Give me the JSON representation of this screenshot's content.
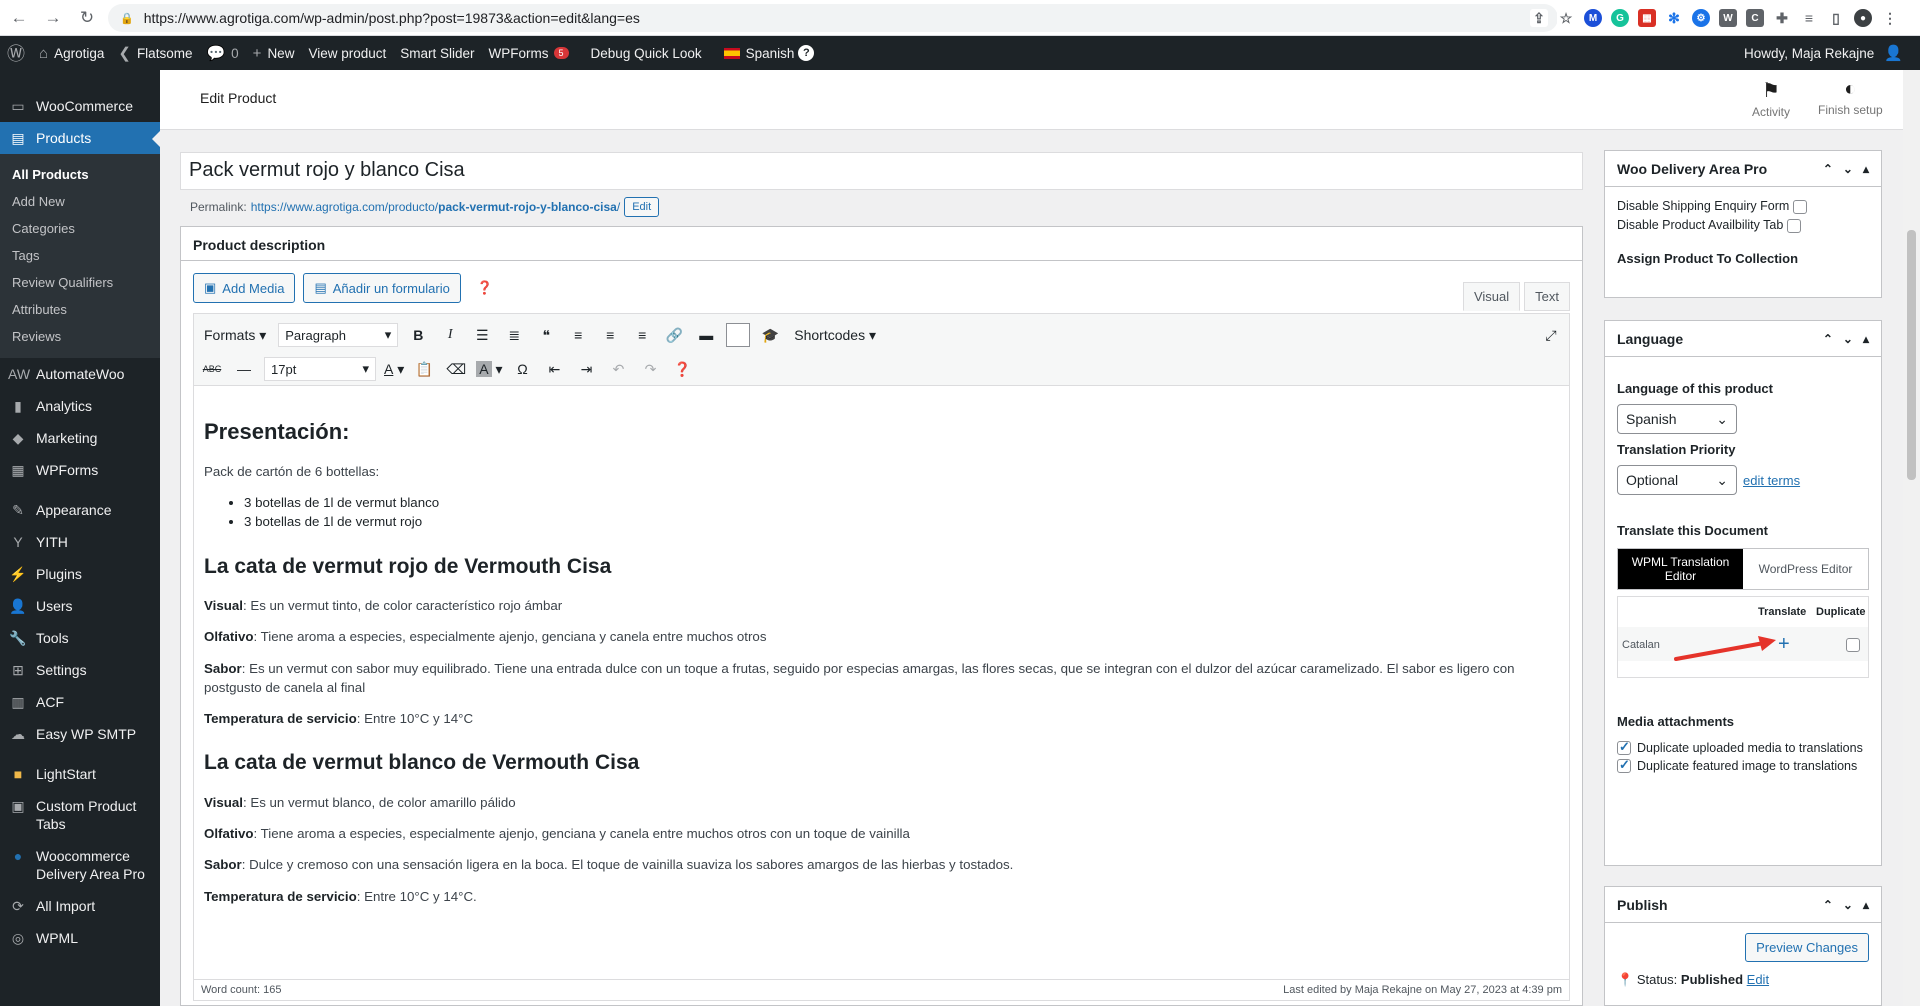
{
  "browser": {
    "url": "https://www.agrotiga.com/wp-admin/post.php?post=19873&action=edit&lang=es"
  },
  "adminbar": {
    "site": "Agrotiga",
    "theme": "Flatsome",
    "comments": "0",
    "new": "New",
    "view_product": "View product",
    "smart_slider": "Smart Slider",
    "wpforms": "WPForms",
    "wpforms_badge": "5",
    "debug": "Debug Quick Look",
    "language": "Spanish",
    "howdy": "Howdy, Maja Rekajne"
  },
  "sidebar": {
    "items": [
      {
        "label": "WooCommerce",
        "icon": "woo-icon"
      },
      {
        "label": "Products",
        "icon": "products-icon"
      },
      {
        "label": "AutomateWoo",
        "icon": "aw-icon"
      },
      {
        "label": "Analytics",
        "icon": "analytics-icon"
      },
      {
        "label": "Marketing",
        "icon": "marketing-icon"
      },
      {
        "label": "WPForms",
        "icon": "wpforms-icon"
      },
      {
        "label": "Appearance",
        "icon": "appearance-icon"
      },
      {
        "label": "YITH",
        "icon": "yith-icon"
      },
      {
        "label": "Plugins",
        "icon": "plugins-icon"
      },
      {
        "label": "Users",
        "icon": "users-icon"
      },
      {
        "label": "Tools",
        "icon": "tools-icon"
      },
      {
        "label": "Settings",
        "icon": "settings-icon"
      },
      {
        "label": "ACF",
        "icon": "acf-icon"
      },
      {
        "label": "Easy WP SMTP",
        "icon": "smtp-icon"
      },
      {
        "label": "LightStart",
        "icon": "lightstart-icon"
      },
      {
        "label": "Custom Product Tabs",
        "icon": "tabs-icon"
      },
      {
        "label": "Woocommerce Delivery Area Pro",
        "icon": "delivery-icon"
      },
      {
        "label": "All Import",
        "icon": "import-icon"
      },
      {
        "label": "WPML",
        "icon": "wpml-icon"
      }
    ],
    "submenu": [
      "All Products",
      "Add New",
      "Categories",
      "Tags",
      "Review Qualifiers",
      "Attributes",
      "Reviews"
    ]
  },
  "header": {
    "title": "Edit Product",
    "activity": "Activity",
    "finish_setup": "Finish setup"
  },
  "post": {
    "title": "Pack vermut rojo y blanco Cisa",
    "permalink_label": "Permalink:",
    "permalink_base": "https://www.agrotiga.com/producto/",
    "permalink_slug": "pack-vermut-rojo-y-blanco-cisa",
    "permalink_end": "/",
    "edit_btn": "Edit"
  },
  "editor": {
    "box_title": "Product description",
    "add_media": "Add Media",
    "add_form": "Añadir un formulario",
    "tab_visual": "Visual",
    "tab_text": "Text",
    "formats": "Formats",
    "paragraph": "Paragraph",
    "shortcodes": "Shortcodes",
    "font_size": "17pt",
    "word_count": "Word count: 165",
    "last_edited": "Last edited by Maja Rekajne on May 27, 2023 at 4:39 pm"
  },
  "content": {
    "h1": "Presentación:",
    "intro": "Pack de cartón de 6 bottellas:",
    "bullets": [
      "3 botellas de 1l de vermut blanco",
      "3 botellas de 1l de vermut rojo"
    ],
    "h2": "La cata de vermut rojo de Vermouth Cisa",
    "r_visual_k": "Visual",
    "r_visual_v": ": Es un vermut tinto, de color característico rojo ámbar",
    "r_olf_k": "Olfativo",
    "r_olf_v": ": Tiene aroma a especies, especialmente ajenjo, genciana y canela entre muchos otros",
    "r_sabor_k": "Sabor",
    "r_sabor_v": ": Es un vermut con sabor muy equilibrado. Tiene una entrada dulce con un toque a frutas, seguido por especias amargas, las flores secas, que se integran con el dulzor del azúcar caramelizado. El sabor es ligero con postgusto de canela al final",
    "r_temp_k": "Temperatura de servicio",
    "r_temp_v": ": Entre 10°C y 14°C",
    "h3": "La cata de vermut blanco de Vermouth Cisa",
    "b_visual_k": "Visual",
    "b_visual_v": ": Es un vermut blanco, de color amarillo pálido",
    "b_olf_k": "Olfativo",
    "b_olf_v": ": Tiene aroma a especies, especialmente ajenjo, genciana y canela entre muchos otros con un toque de vainilla",
    "b_sabor_k": "Sabor",
    "b_sabor_v": ": Dulce y cremoso con una sensación ligera en la boca. El toque de vainilla suaviza los sabores amargos de las hierbas y tostados.",
    "b_temp_k": "Temperatura de servicio",
    "b_temp_v": ": Entre 10°C y 14°C."
  },
  "delivery_box": {
    "title": "Woo Delivery Area Pro",
    "opt1": "Disable Shipping Enquiry Form",
    "opt2": "Disable Product Availbility Tab",
    "assign": "Assign Product To Collection"
  },
  "language_box": {
    "title": "Language",
    "lang_label": "Language of this product",
    "lang_value": "Spanish",
    "priority_label": "Translation Priority",
    "priority_value": "Optional",
    "edit_terms": "edit terms",
    "translate_label": "Translate this Document",
    "tab_wpml": "WPML Translation Editor",
    "tab_wp": "WordPress Editor",
    "col_translate": "Translate",
    "col_duplicate": "Duplicate",
    "row_lang": "Catalan",
    "media_label": "Media attachments",
    "media_opt1": "Duplicate uploaded media to translations",
    "media_opt2": "Duplicate featured image to translations"
  },
  "publish_box": {
    "title": "Publish",
    "preview": "Preview Changes",
    "status_label": "Status:",
    "status_value": "Published",
    "status_edit": "Edit"
  }
}
